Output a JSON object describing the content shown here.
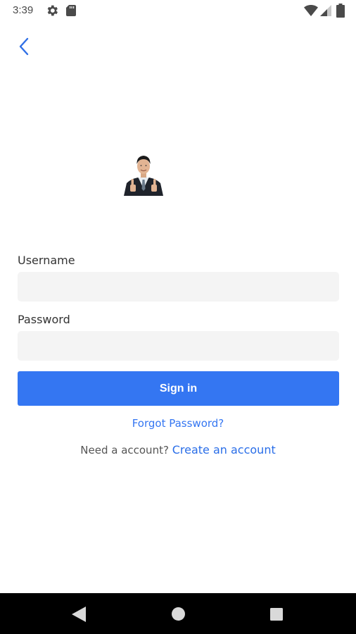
{
  "status_bar": {
    "time": "3:39",
    "icons": [
      "gear-icon",
      "sd-card-icon",
      "wifi-icon",
      "signal-icon",
      "battery-icon"
    ]
  },
  "header": {
    "back_icon": "chevron-left-icon"
  },
  "colors": {
    "accent": "#3476f2",
    "input_background": "#f4f4f4",
    "nav_bar": "#000000"
  },
  "form": {
    "username_label": "Username",
    "username_value": "",
    "password_label": "Password",
    "password_value": "",
    "signin_label": "Sign in",
    "forgot_label": "Forgot Password?",
    "signup_prompt": "Need a account?",
    "signup_link": "Create an account"
  },
  "nav_bar": {
    "icons": [
      "nav-back-icon",
      "nav-home-icon",
      "nav-recents-icon"
    ]
  }
}
